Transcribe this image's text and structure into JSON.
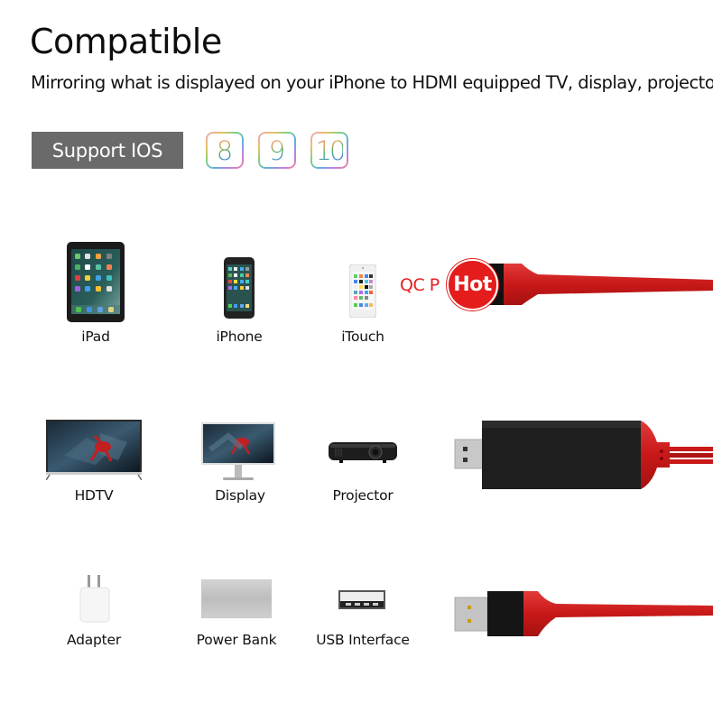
{
  "header": {
    "title": "Compatible",
    "subtitle": "Mirroring what is displayed on your iPhone to HDMI equipped TV, display, projector"
  },
  "support": {
    "label": "Support IOS",
    "versions": [
      "8",
      "9",
      "10"
    ]
  },
  "devices": {
    "row1": [
      {
        "label": "iPad",
        "icon": "ipad-icon"
      },
      {
        "label": "iPhone",
        "icon": "iphone-icon"
      },
      {
        "label": "iTouch",
        "icon": "ipod-touch-icon"
      }
    ],
    "row2": [
      {
        "label": "HDTV",
        "icon": "hdtv-icon"
      },
      {
        "label": "Display",
        "icon": "monitor-icon"
      },
      {
        "label": "Projector",
        "icon": "projector-icon"
      }
    ],
    "row3": [
      {
        "label": "Adapter",
        "icon": "power-adapter-icon"
      },
      {
        "label": "Power Bank",
        "icon": "power-bank-icon"
      },
      {
        "label": "USB Interface",
        "icon": "usb-port-icon"
      }
    ]
  },
  "promo": {
    "partial_text": "QC P",
    "hot_label": "Hot"
  },
  "colors": {
    "cable_red": "#d42020",
    "badge_red": "#e41c1c",
    "badge_gray": "#6a6a6a"
  }
}
